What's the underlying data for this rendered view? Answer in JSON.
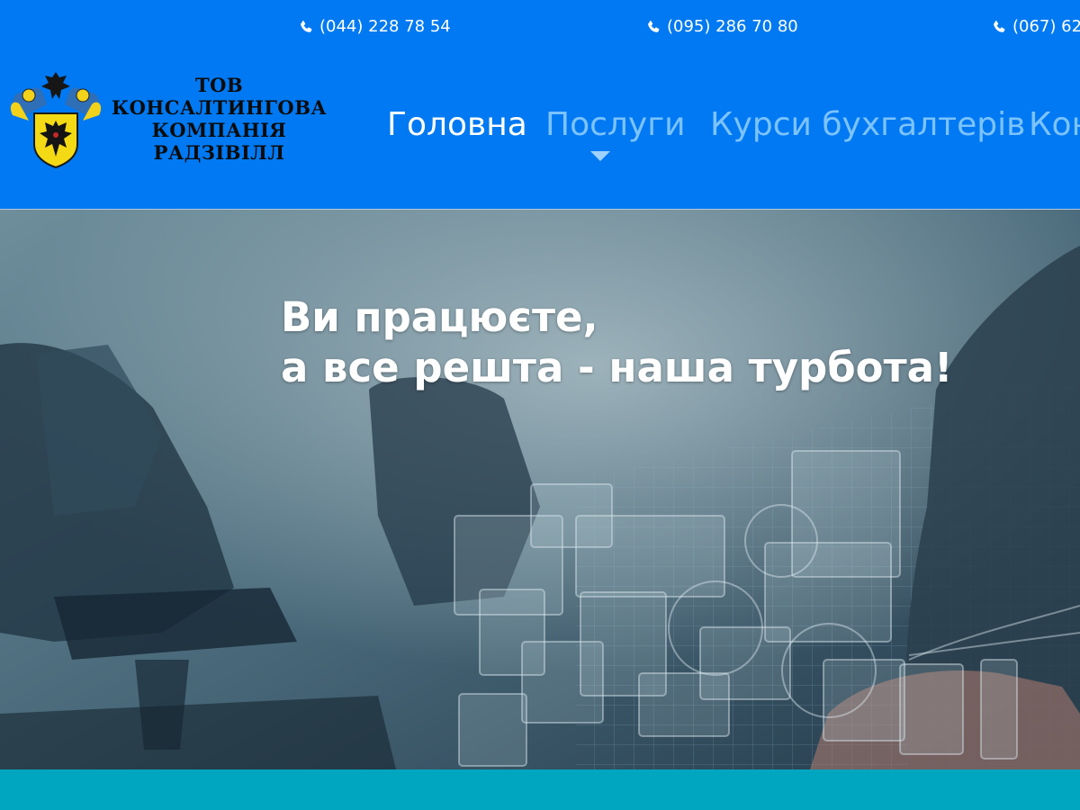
{
  "header": {
    "phones": [
      {
        "number": "(044) 228 78 54",
        "icon": "phone-icon"
      },
      {
        "number": "(095) 286 70 80",
        "icon": "phone-icon"
      },
      {
        "number": "(067) 62",
        "icon": "phone-icon"
      }
    ],
    "logo": {
      "lines": [
        "ТОВ",
        "КОНСАЛТИНГОВА",
        "КОМПАНІЯ",
        "РАДЗІВІЛЛ"
      ],
      "emblem": "coat-of-arms-icon"
    },
    "nav": {
      "home": "Головна",
      "services": "Послуги",
      "courses": "Курси бухгалтерів",
      "contacts": "Кон"
    }
  },
  "hero": {
    "title_line1": "Ви працюєте,",
    "title_line2": "а все решта - наша турбота!"
  },
  "colors": {
    "header_bg": "#0079f2",
    "nav_active": "#ffffff",
    "nav_inactive": "#7cc3ff",
    "bottom_band": "#00a6c0"
  }
}
